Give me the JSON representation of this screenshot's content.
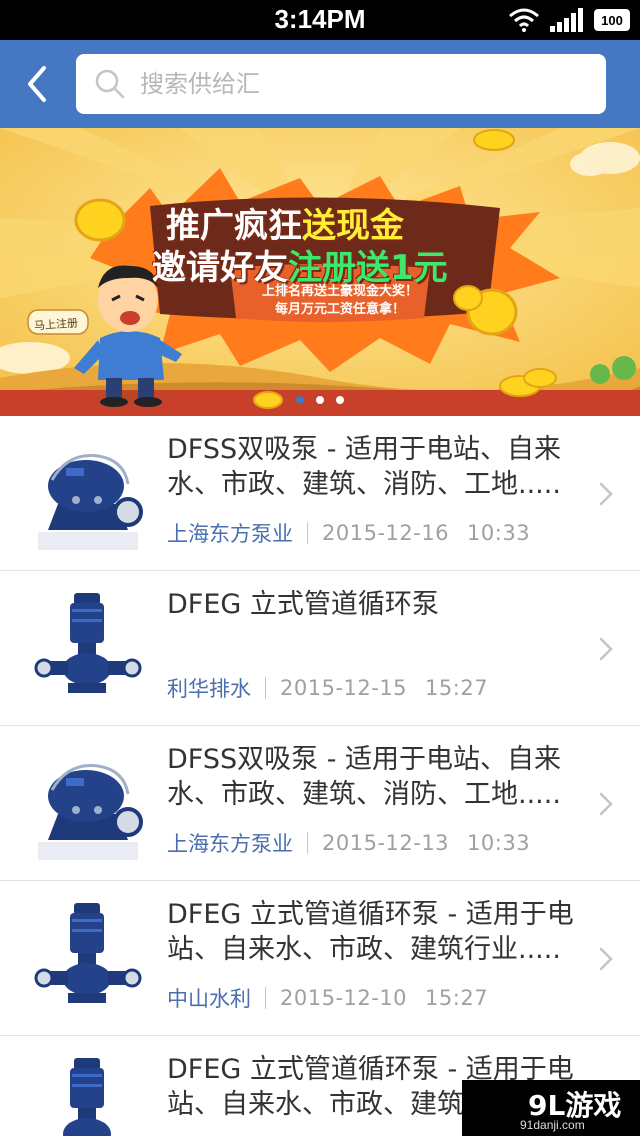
{
  "status_bar": {
    "time": "3:14PM",
    "battery": "100"
  },
  "header": {
    "search_placeholder": "搜索供给汇"
  },
  "banner": {
    "title_line1_a": "推广疯狂",
    "title_line1_b": "送现金",
    "title_line2_a": "邀请好友",
    "title_line2_b": "注册送1元",
    "subtitle1": "上排名再送土豪现金大奖！",
    "subtitle2": "每月万元工资任意拿！",
    "register_tag": "马上注册",
    "slide_count": 3,
    "active_slide": 0
  },
  "items": [
    {
      "title": "DFSS双吸泵 - 适用于电站、自来水、市政、建筑、消防、工地.....",
      "company": "上海东方泵业",
      "date": "2015-12-16",
      "time": "10:33",
      "thumb": "split-case-pump-icon"
    },
    {
      "title": "DFEG 立式管道循环泵",
      "company": "利华排水",
      "date": "2015-12-15",
      "time": "15:27",
      "thumb": "vertical-pump-icon"
    },
    {
      "title": "DFSS双吸泵 - 适用于电站、自来水、市政、建筑、消防、工地.....",
      "company": "上海东方泵业",
      "date": "2015-12-13",
      "time": "10:33",
      "thumb": "split-case-pump-icon"
    },
    {
      "title": "DFEG 立式管道循环泵 - 适用于电站、自来水、市政、建筑行业.....",
      "company": "中山水利",
      "date": "2015-12-10",
      "time": "15:27",
      "thumb": "vertical-pump-icon"
    },
    {
      "title": "DFEG 立式管道循环泵 - 适用于电站、自来水、市政、建筑行业.....",
      "company": "",
      "date": "",
      "time": "",
      "thumb": "vertical-pump-icon"
    }
  ],
  "watermark": {
    "logo": "9L游戏",
    "site": "91danji.com"
  },
  "colors": {
    "header_blue": "#4577c2",
    "company_blue": "#4a6fae",
    "meta_gray": "#a0a0a0"
  }
}
